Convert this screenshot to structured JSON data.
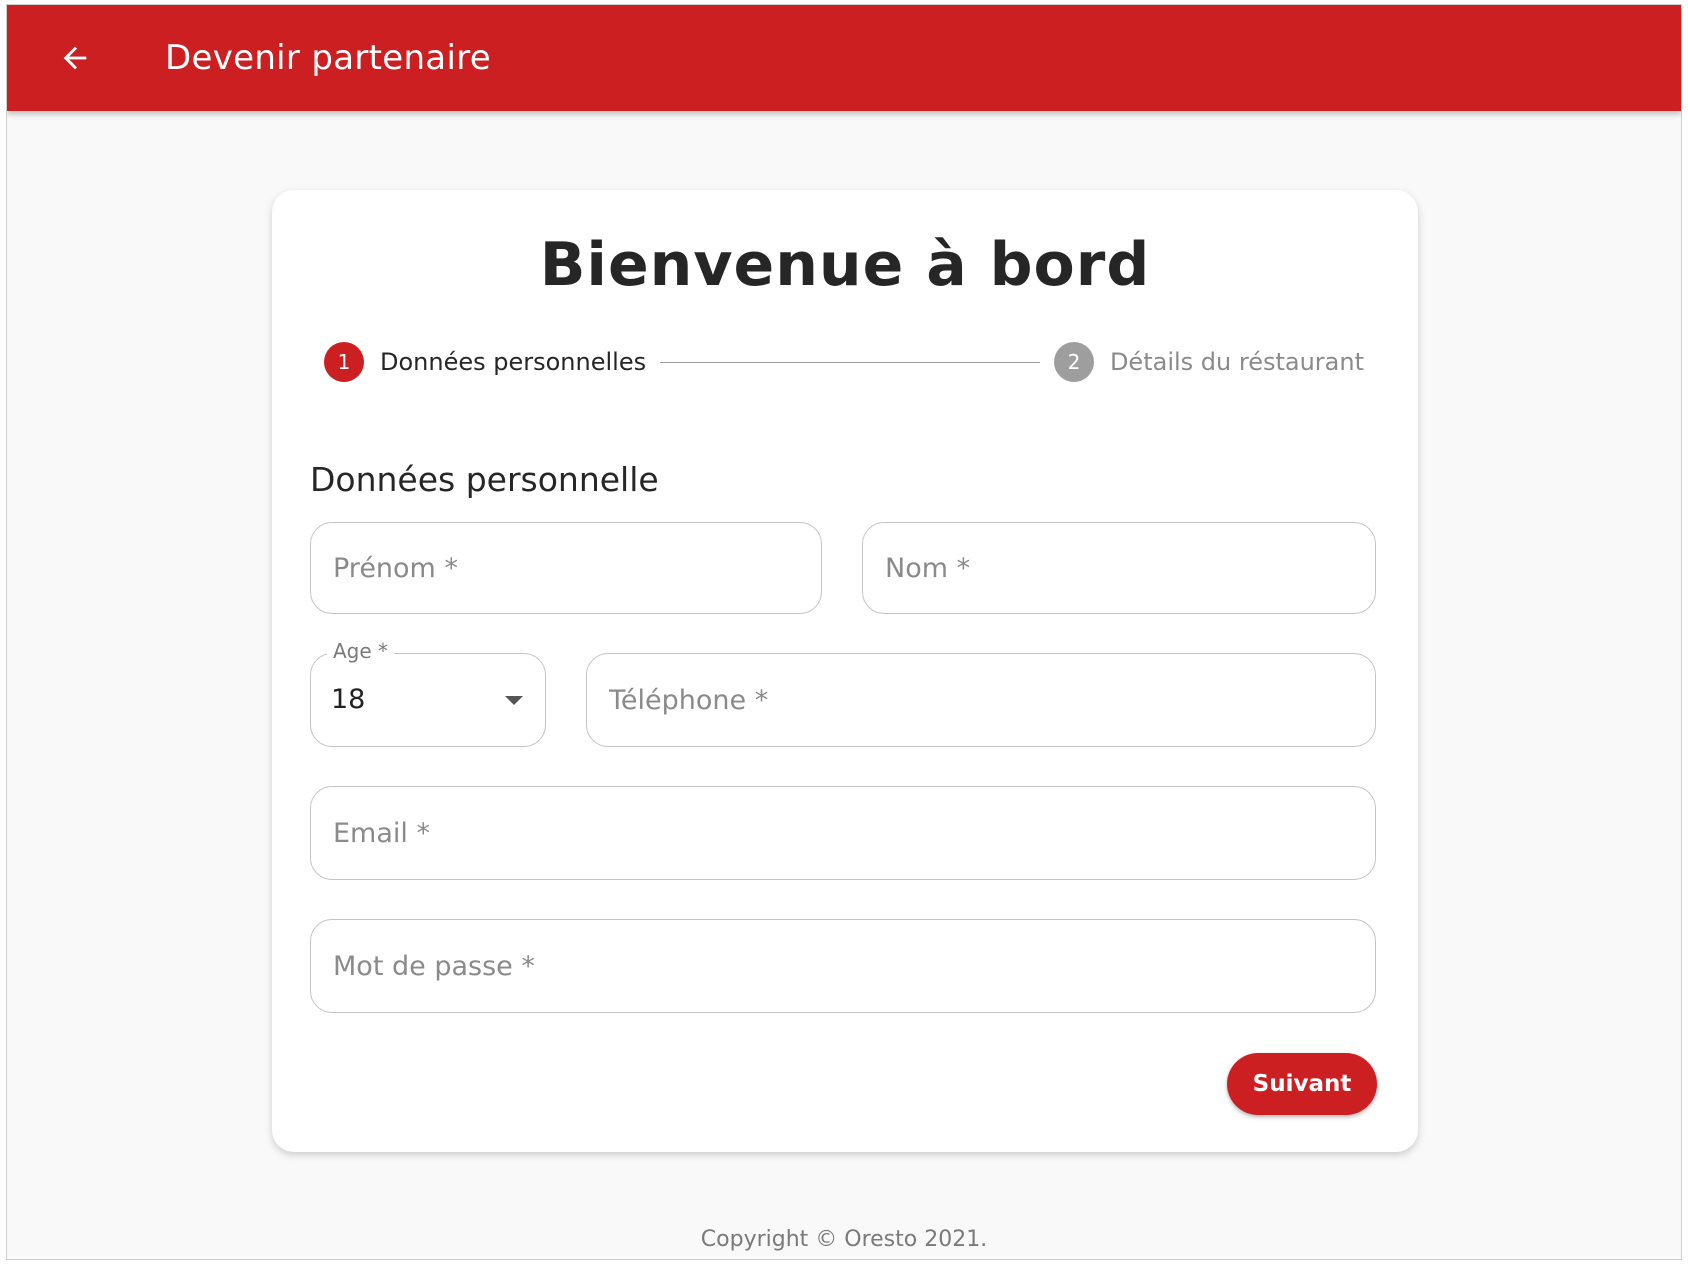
{
  "appbar": {
    "title": "Devenir partenaire",
    "back_icon": "arrow-left-icon",
    "color": "#cc1f22"
  },
  "card": {
    "title": "Bienvenue à bord"
  },
  "stepper": {
    "steps": [
      {
        "number": "1",
        "label": "Données personnelles",
        "active": true,
        "color": "#cc1f22"
      },
      {
        "number": "2",
        "label": "Détails du réstaurant",
        "active": false,
        "color": "#9e9e9e"
      }
    ]
  },
  "form": {
    "section_title": "Données personnelle",
    "first_name": {
      "placeholder": "Prénom *",
      "value": ""
    },
    "last_name": {
      "placeholder": "Nom *",
      "value": ""
    },
    "age": {
      "label": "Age *",
      "value": "18"
    },
    "phone": {
      "placeholder": "Téléphone *",
      "value": ""
    },
    "email": {
      "placeholder": "Email *",
      "value": ""
    },
    "password": {
      "placeholder": "Mot de passe *",
      "value": ""
    },
    "next_label": "Suivant"
  },
  "footer": {
    "copyright": "Copyright © Oresto 2021."
  }
}
